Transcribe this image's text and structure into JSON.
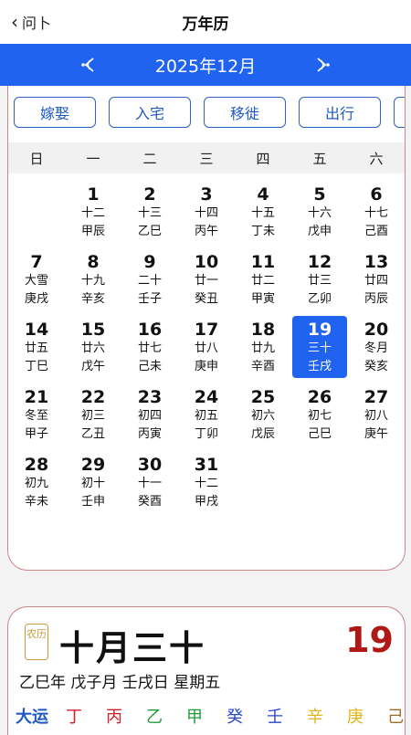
{
  "nav": {
    "back_label": "问卜",
    "title": "万年历"
  },
  "month_bar": {
    "label": "2025年12月"
  },
  "chips": [
    "嫁娶",
    "入宅",
    "移徙",
    "出行"
  ],
  "weekdays": [
    "日",
    "一",
    "二",
    "三",
    "四",
    "五",
    "六"
  ],
  "calendar": {
    "weeks": [
      [
        null,
        {
          "d": "1",
          "l1": "十二",
          "l2": "甲辰"
        },
        {
          "d": "2",
          "l1": "十三",
          "l2": "乙巳"
        },
        {
          "d": "3",
          "l1": "十四",
          "l2": "丙午"
        },
        {
          "d": "4",
          "l1": "十五",
          "l2": "丁未"
        },
        {
          "d": "5",
          "l1": "十六",
          "l2": "戊申"
        },
        {
          "d": "6",
          "l1": "十七",
          "l2": "己酉"
        }
      ],
      [
        {
          "d": "7",
          "l1": "大雪",
          "l2": "庚戌"
        },
        {
          "d": "8",
          "l1": "十九",
          "l2": "辛亥"
        },
        {
          "d": "9",
          "l1": "二十",
          "l2": "壬子"
        },
        {
          "d": "10",
          "l1": "廿一",
          "l2": "癸丑"
        },
        {
          "d": "11",
          "l1": "廿二",
          "l2": "甲寅"
        },
        {
          "d": "12",
          "l1": "廿三",
          "l2": "乙卯"
        },
        {
          "d": "13",
          "l1": "廿四",
          "l2": "丙辰"
        }
      ],
      [
        {
          "d": "14",
          "l1": "廿五",
          "l2": "丁巳"
        },
        {
          "d": "15",
          "l1": "廿六",
          "l2": "戊午"
        },
        {
          "d": "16",
          "l1": "廿七",
          "l2": "己未"
        },
        {
          "d": "17",
          "l1": "廿八",
          "l2": "庚申"
        },
        {
          "d": "18",
          "l1": "廿九",
          "l2": "辛酉"
        },
        {
          "d": "19",
          "l1": "三十",
          "l2": "壬戌",
          "selected": true
        },
        {
          "d": "20",
          "l1": "冬月",
          "l2": "癸亥"
        }
      ],
      [
        {
          "d": "21",
          "l1": "冬至",
          "l2": "甲子"
        },
        {
          "d": "22",
          "l1": "初三",
          "l2": "乙丑"
        },
        {
          "d": "23",
          "l1": "初四",
          "l2": "丙寅"
        },
        {
          "d": "24",
          "l1": "初五",
          "l2": "丁卯"
        },
        {
          "d": "25",
          "l1": "初六",
          "l2": "戊辰"
        },
        {
          "d": "26",
          "l1": "初七",
          "l2": "己巳"
        },
        {
          "d": "27",
          "l1": "初八",
          "l2": "庚午"
        }
      ],
      [
        {
          "d": "28",
          "l1": "初九",
          "l2": "辛未"
        },
        {
          "d": "29",
          "l1": "初十",
          "l2": "壬申"
        },
        {
          "d": "30",
          "l1": "十一",
          "l2": "癸酉"
        },
        {
          "d": "31",
          "l1": "十二",
          "l2": "甲戌"
        },
        null,
        null,
        null
      ]
    ]
  },
  "detail": {
    "seal_text": "农历",
    "lunar_date": "十月三十",
    "day_number": "19",
    "ganzhi": "乙巳年 戊子月 壬戌日 星期五",
    "dayun_label": "大运",
    "stems": [
      {
        "t": "丁",
        "color": "#d0202a"
      },
      {
        "t": "丙",
        "color": "#d0202a"
      },
      {
        "t": "乙",
        "color": "#1f9a3a"
      },
      {
        "t": "甲",
        "color": "#1f9a3a"
      },
      {
        "t": "癸",
        "color": "#2a46c8"
      },
      {
        "t": "壬",
        "color": "#2a46c8"
      },
      {
        "t": "辛",
        "color": "#e0b418"
      },
      {
        "t": "庚",
        "color": "#e0b418"
      },
      {
        "t": "己",
        "color": "#9a6a2a"
      }
    ]
  },
  "colors": {
    "accent": "#1f63f0",
    "border": "#c9878a",
    "day_big": "#b01818"
  }
}
